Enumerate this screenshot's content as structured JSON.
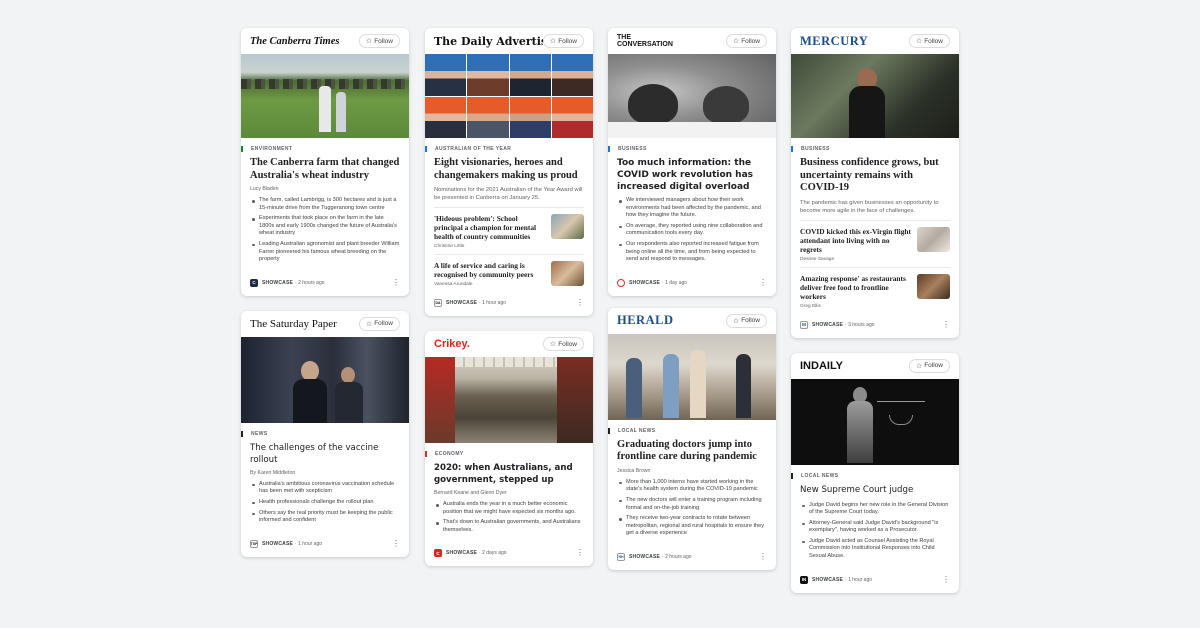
{
  "follow_label": "Follow",
  "showcase_label": "SHOWCASE",
  "cards": {
    "canberra": {
      "publisher": "The Canberra Times",
      "section": "ENVIRONMENT",
      "title": "The Canberra farm that changed Australia's wheat industry",
      "byline": "Lucy Bladen",
      "bullets": [
        "The farm, called Lambrigg, is 300 hectares and is just a 15-minute drive from the Tuggeranong town centre",
        "Experiments that took place on the farm in the late 1800s and early 1900s changed the future of Australia's wheat industry",
        "Leading Australian agronomist and plant breeder William Farrer pioneered his famous wheat breeding on the property"
      ],
      "time": "2 hours ago"
    },
    "saturday": {
      "publisher": "The Saturday Paper",
      "section": "NEWS",
      "title": "The challenges of the vaccine rollout",
      "byline": "By Karen Middleton",
      "bullets": [
        "Australia's ambitious coronavirus vaccination schedule has been met with scepticism",
        "Health professionals challenge the rollout plan",
        "Others say the real priority must be keeping the public informed and confident"
      ],
      "time": "1 hour ago"
    },
    "advertiser": {
      "publisher": "The Daily Advertiser",
      "section": "AUSTRALIAN OF THE YEAR",
      "title": "Eight visionaries, heroes and changemakers making us proud",
      "summary": "Nominations for the 2021 Australian of the Year Award will be presented in Canberra on January 25.",
      "related": [
        {
          "title": "'Hideous problem': School principal a champion for mental health of country communities",
          "by": "Christine Little"
        },
        {
          "title": "A life of service and caring is recognised by community peers",
          "by": "Vanessa Arundale"
        }
      ],
      "time": "1 hour ago"
    },
    "crikey": {
      "publisher": "Crikey.",
      "section": "ECONOMY",
      "title": "2020: when Australians, and government, stepped up",
      "byline": "Bernard Keane and Glenn Dyer",
      "bullets": [
        "Australia ends the year in a much better economic position that we might have expected six months ago.",
        "That's down to Australian governments, and Australians themselves."
      ],
      "time": "2 days ago"
    },
    "conversation": {
      "publisher_top": "THE",
      "publisher_bottom": "CONVERSATION",
      "section": "BUSINESS",
      "title": "Too much information: the COVID work revolution has increased digital overload",
      "bullets": [
        "We interviewed managers about how their work environments had been affected by the pandemic, and how they imagine the future.",
        "On average, they reported using nine collaboration and communication tools every day.",
        "Our respondents also reported increased fatigue from being online all the time, and from being expected to send and respond to messages."
      ],
      "time": "1 day ago"
    },
    "herald": {
      "publisher": "HERALD",
      "section": "LOCAL NEWS",
      "title": "Graduating doctors jump into frontline care during pandemic",
      "byline": "Jessica Brown",
      "bullets": [
        "More than 1,000 interns have started working in the state's health system during the COVID-19 pandemic",
        "The new doctors will enter a training program including formal and on-the-job training",
        "They receive two-year contracts to rotate between metropolitan, regional and rural hospitals to ensure they get a diverse experience"
      ],
      "time": "2 hours ago"
    },
    "mercury": {
      "publisher": "MERCURY",
      "section": "BUSINESS",
      "title": "Business confidence grows, but uncertainty remains with COVID-19",
      "summary": "The pandemic has given businesses an opportunity to become more agile in the face of challenges.",
      "related": [
        {
          "title": "COVID kicked this ex-Virgin flight attendant into living with no regrets",
          "by": "Desiree Savage"
        },
        {
          "title": "Amazing response' as restaurants deliver free food to frontline workers",
          "by": "Greg Ellis"
        }
      ],
      "time": "3 hours ago"
    },
    "indaily": {
      "publisher": "INDAILY",
      "section": "LOCAL NEWS",
      "title": "New Supreme Court judge",
      "bullets": [
        "Judge David begins her new role in the General Division of the Supreme Court today.",
        "Attorney-General said Judge David's background \"is exemplary\", having worked as a Prosecutor.",
        "Judge David acted as Counsel Assisting the Royal Commission into Institutional Responses into Child Sexual Abuse."
      ],
      "time": "1 hour ago"
    }
  }
}
